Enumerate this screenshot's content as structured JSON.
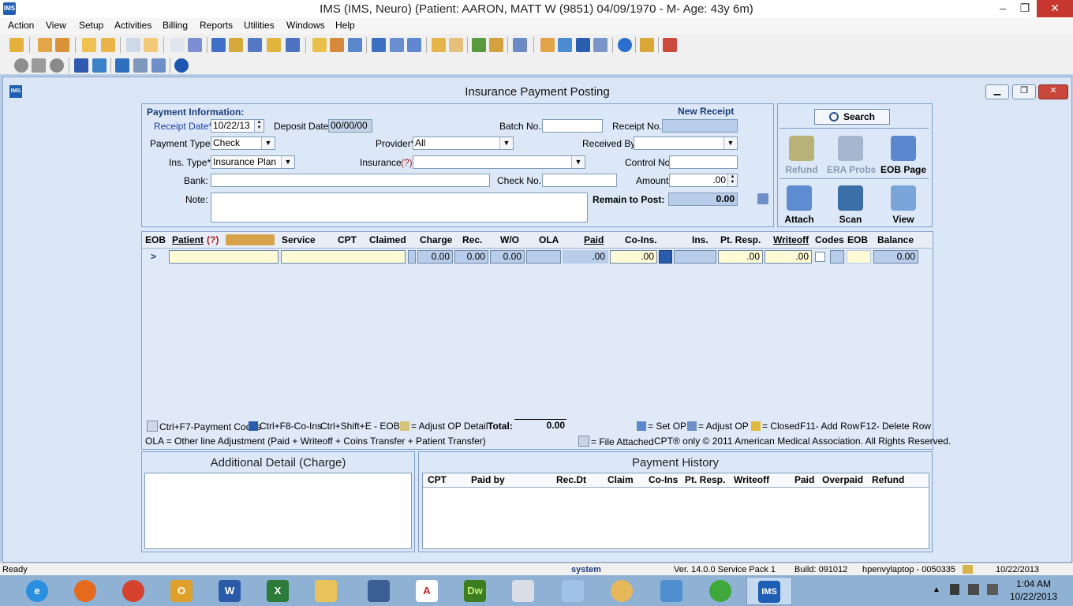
{
  "window": {
    "title": "IMS (IMS, Neuro)    (Patient: AARON, MATT W (9851) 04/09/1970 - M- Age: 43y 6m)",
    "app_icon": "IMS",
    "minimize": "–",
    "restore": "❐",
    "close": "✕"
  },
  "menu": [
    "Action",
    "View",
    "Setup",
    "Activities",
    "Billing",
    "Reports",
    "Utilities",
    "Windows",
    "Help"
  ],
  "child": {
    "title": "Insurance Payment Posting",
    "icon": "IMS"
  },
  "payment_info": {
    "heading": "Payment Information:",
    "new_receipt": "New Receipt",
    "receipt_date_label": "Receipt Date*",
    "receipt_date": "10/22/13",
    "deposit_date_label": "Deposit Date:",
    "deposit_date": "00/00/00",
    "batch_label": "Batch No.:",
    "batch_value": "",
    "receipt_no_label": "Receipt No.:",
    "receipt_no_value": "",
    "payment_type_label": "Payment Type*",
    "payment_type": "Check",
    "provider_label": "Provider*",
    "provider": "All",
    "received_by_label": "Received By:",
    "received_by": "",
    "ins_type_label": "Ins. Type*",
    "ins_type": "Insurance Plan",
    "insurance_label": "Insurance",
    "insurance_help": "(?)",
    "insurance": "",
    "control_label": "Control No:",
    "control_value": "",
    "bank_label": "Bank:",
    "bank_value": "",
    "check_label": "Check No.:",
    "check_value": "",
    "amount_label": "Amount:",
    "amount": ".00",
    "note_label": "Note:",
    "note_value": "",
    "remain_label": "Remain to Post:",
    "remain": "0.00"
  },
  "actions": {
    "search": "Search",
    "refund": "Refund",
    "era_probs": "ERA Probs",
    "eob_page": "EOB Page",
    "attach": "Attach",
    "scan": "Scan",
    "view": "View"
  },
  "grid": {
    "headers": {
      "eob": "EOB",
      "patient": "Patient",
      "patient_help": "(?)",
      "service": "Service",
      "cpt": "CPT",
      "claimed": "Claimed",
      "charge": "Charge",
      "rec": "Rec.",
      "wo": "W/O",
      "ola": "OLA",
      "paid": "Paid",
      "coins": "Co-Ins.",
      "ins": "Ins.",
      "pt_resp": "Pt. Resp.",
      "writeoff": "Writeoff",
      "codes": "Codes",
      "eob2": "EOB",
      "balance": "Balance"
    },
    "row": {
      "marker": ">",
      "charge": "0.00",
      "rec": "0.00",
      "wo": "0.00",
      "paid": ".00",
      "coins": ".00",
      "pt_resp": ".00",
      "writeoff": ".00",
      "balance": "0.00"
    },
    "legend": {
      "payment_codes": "Ctrl+F7-Payment Codes",
      "coins": "Ctrl+F8-Co-Ins",
      "eob": "Ctrl+Shift+E - EOB",
      "adjust_op_detail": "= Adjust OP Detail",
      "total_label": "Total:",
      "total": "0.00",
      "set_op": "= Set OP",
      "adjust_op": "= Adjust OP",
      "closed": "= Closed",
      "add_row": "F11- Add Row",
      "delete_row": "F12- Delete Row",
      "ola_note": "OLA = Other line Adjustment (Paid + Writeoff + Coins Transfer + Patient Transfer)",
      "file_attached": "= File Attached",
      "copyright": "CPT® only © 2011 American Medical Association.  All Rights Reserved."
    }
  },
  "additional_detail": {
    "title": "Additional Detail (Charge)"
  },
  "payment_history": {
    "title": "Payment History",
    "columns": [
      "CPT",
      "Paid by",
      "Rec.Dt",
      "Claim",
      "Co-Ins",
      "Pt. Resp.",
      "Writeoff",
      "Paid",
      "Overpaid",
      "Refund"
    ]
  },
  "status": {
    "ready": "Ready",
    "user": "system",
    "version": "Ver. 14.0.0 Service Pack 1",
    "build": "Build: 091012",
    "machine": "hpenvylaptop - 0050335",
    "date": "10/22/2013"
  },
  "taskbar": {
    "time": "1:04 AM",
    "date": "10/22/2013"
  }
}
